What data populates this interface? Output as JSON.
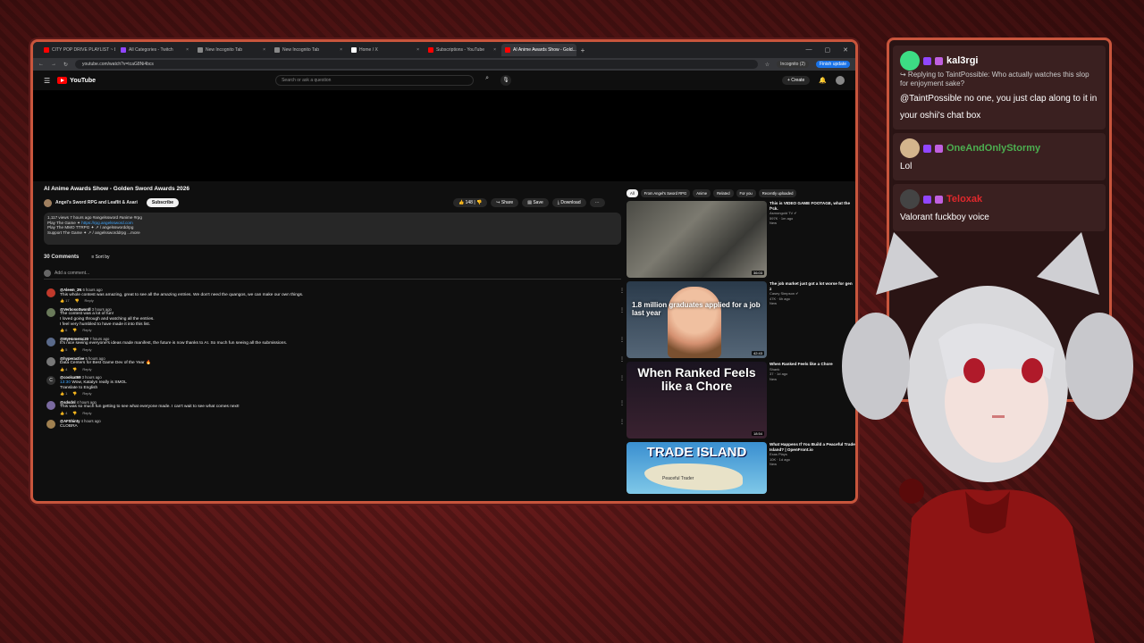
{
  "browser": {
    "tabs": [
      {
        "label": "CITY POP DRIVE PLAYLIST ~ 8...",
        "color": "#ff0000",
        "active": false
      },
      {
        "label": "All Categories - Twitch",
        "color": "#9146ff",
        "active": false
      },
      {
        "label": "New Incognito Tab",
        "color": "#888888",
        "active": false
      },
      {
        "label": "New Incognito Tab",
        "color": "#888888",
        "active": false
      },
      {
        "label": "Home / X",
        "color": "#ffffff",
        "active": false
      },
      {
        "label": "Subscriptions - YouTube",
        "color": "#ff0000",
        "active": false
      },
      {
        "label": "AI Anime Awards Show - Gold...",
        "color": "#ff0000",
        "active": true
      }
    ],
    "url": "youtube.com/watch?v=tcaG8Ni4bcs",
    "incognito": "Incognito (2)",
    "update": "Finish update"
  },
  "youtube": {
    "logo": "YouTube",
    "search_placeholder": "Search or ask a question",
    "create": "Create"
  },
  "video": {
    "title": "AI Anime Awards Show - Golden Sword Awards 2026",
    "channel": "Angel's Sword RPG and Leaflit & Asari",
    "subscribe": "Subscribe",
    "likes": "148",
    "share": "Share",
    "save": "Save",
    "download": "Download",
    "desc_line1": "1,117 views  7 hours ago  #angelssword #anime #rpg",
    "desc_line2a": "Play The Game ✦ ",
    "desc_line2b": "https://rpg.angelssword.com",
    "desc_line3": "Play The MMO TTRPG ✦  ↗ / angelssworddrpg",
    "desc_line4": "Support The Game ✦  ↗ / angelssworddrpg   ...more"
  },
  "comments": {
    "count": "30 Comments",
    "sort": "Sort by",
    "add": "Add a comment...",
    "items": [
      {
        "user": "@Aleem_2N",
        "time": "6 hours ago",
        "text": "This whole contest was amazing, great to see all the amazing entries. We don't need the quangos, we can make our own things.",
        "likes": "17",
        "color": "#c0392b"
      },
      {
        "user": "@VerbosoSwordl",
        "time": "3 hours ago",
        "text": "The contest was a lot of fun!\nI loved going through and watching all the entries.\nI feel very humbled to have made it into this list.",
        "likes": "6",
        "color": "#6a7a5a"
      },
      {
        "user": "@MyHomeIsc20",
        "time": "7 hours ago",
        "text": "It's nice seeing everyone's ideas made manifest, the future is now thanks to AI. So much fun seeing all the submissions.",
        "likes": "5",
        "color": "#5a6a8a"
      },
      {
        "user": "@hyperactive",
        "time": "5 hours ago",
        "text": "Data Centers for Best Game Dev of the Year 🔥",
        "likes": "4",
        "color": "#777777"
      },
      {
        "user": "@coolcat69",
        "time": "3 hours ago",
        "ts": "13:30",
        "text": " Wow, Katalyn really is SMOL\nTranslate to English",
        "likes": "1",
        "color": "#333333",
        "initial": "C"
      },
      {
        "user": "@sdsdnl",
        "time": "4 hours ago",
        "text": "This was so much fun getting to see what everyone made. I can't wait to see what comes next!",
        "likes": "4",
        "color": "#7a6aa0"
      },
      {
        "user": "@AFShinty",
        "time": "4 hours ago",
        "text": "CLOBRA",
        "likes": "",
        "color": "#a08050"
      }
    ]
  },
  "sidebar": {
    "chips": [
      "All",
      "From Angel's Sword RPG",
      "Anime",
      "Related",
      "For you",
      "Recently uploaded"
    ],
    "videos": [
      {
        "title": "This is VIDEO GAME FOOTAGE, what the f*ck.",
        "channel": "Asmongold TV ✔",
        "meta": "597K · 1m ago",
        "badge": "New",
        "duration": "36:03",
        "caption": ""
      },
      {
        "title": "The job market just got a lot worse for gen z",
        "channel": "Casey Simpson ✔",
        "meta": "47K · 6h ago",
        "badge": "New",
        "duration": "42:43",
        "caption": "1.8 million graduates applied for a job last year"
      },
      {
        "title": "When Ranked Feels like a Chore",
        "channel": "Shank",
        "meta": "37 · 1d ago",
        "badge": "New",
        "duration": "18:54",
        "caption": "When Ranked Feels like a Chore"
      },
      {
        "title": "What Happens If You Build a Peaceful Trade Island? | OpenFront.io",
        "channel": "Exas Plays",
        "meta": "10K · 1d ago",
        "badge": "New",
        "duration": "",
        "caption": "TRADE ISLAND",
        "sub_caption": "Peaceful Trader"
      }
    ]
  },
  "chat": {
    "messages": [
      {
        "user": "kal3rgi",
        "user_color": "#ffffff",
        "reply": "↪ Replying to TaintPossible: Who actually watches this slop for enjoyment sake?",
        "body": "@TaintPossible no one, you just clap along to it in your oshii's chat box",
        "avatar": "#3ddc84"
      },
      {
        "user": "OneAndOnlyStormy",
        "user_color": "#4caf50",
        "reply": "",
        "body": "Lol",
        "avatar": "#d4b48c"
      },
      {
        "user": "Teloxak",
        "user_color": "#e0282c",
        "reply": "",
        "body": "Valorant fuckboy voice",
        "avatar": "#444444"
      }
    ]
  }
}
